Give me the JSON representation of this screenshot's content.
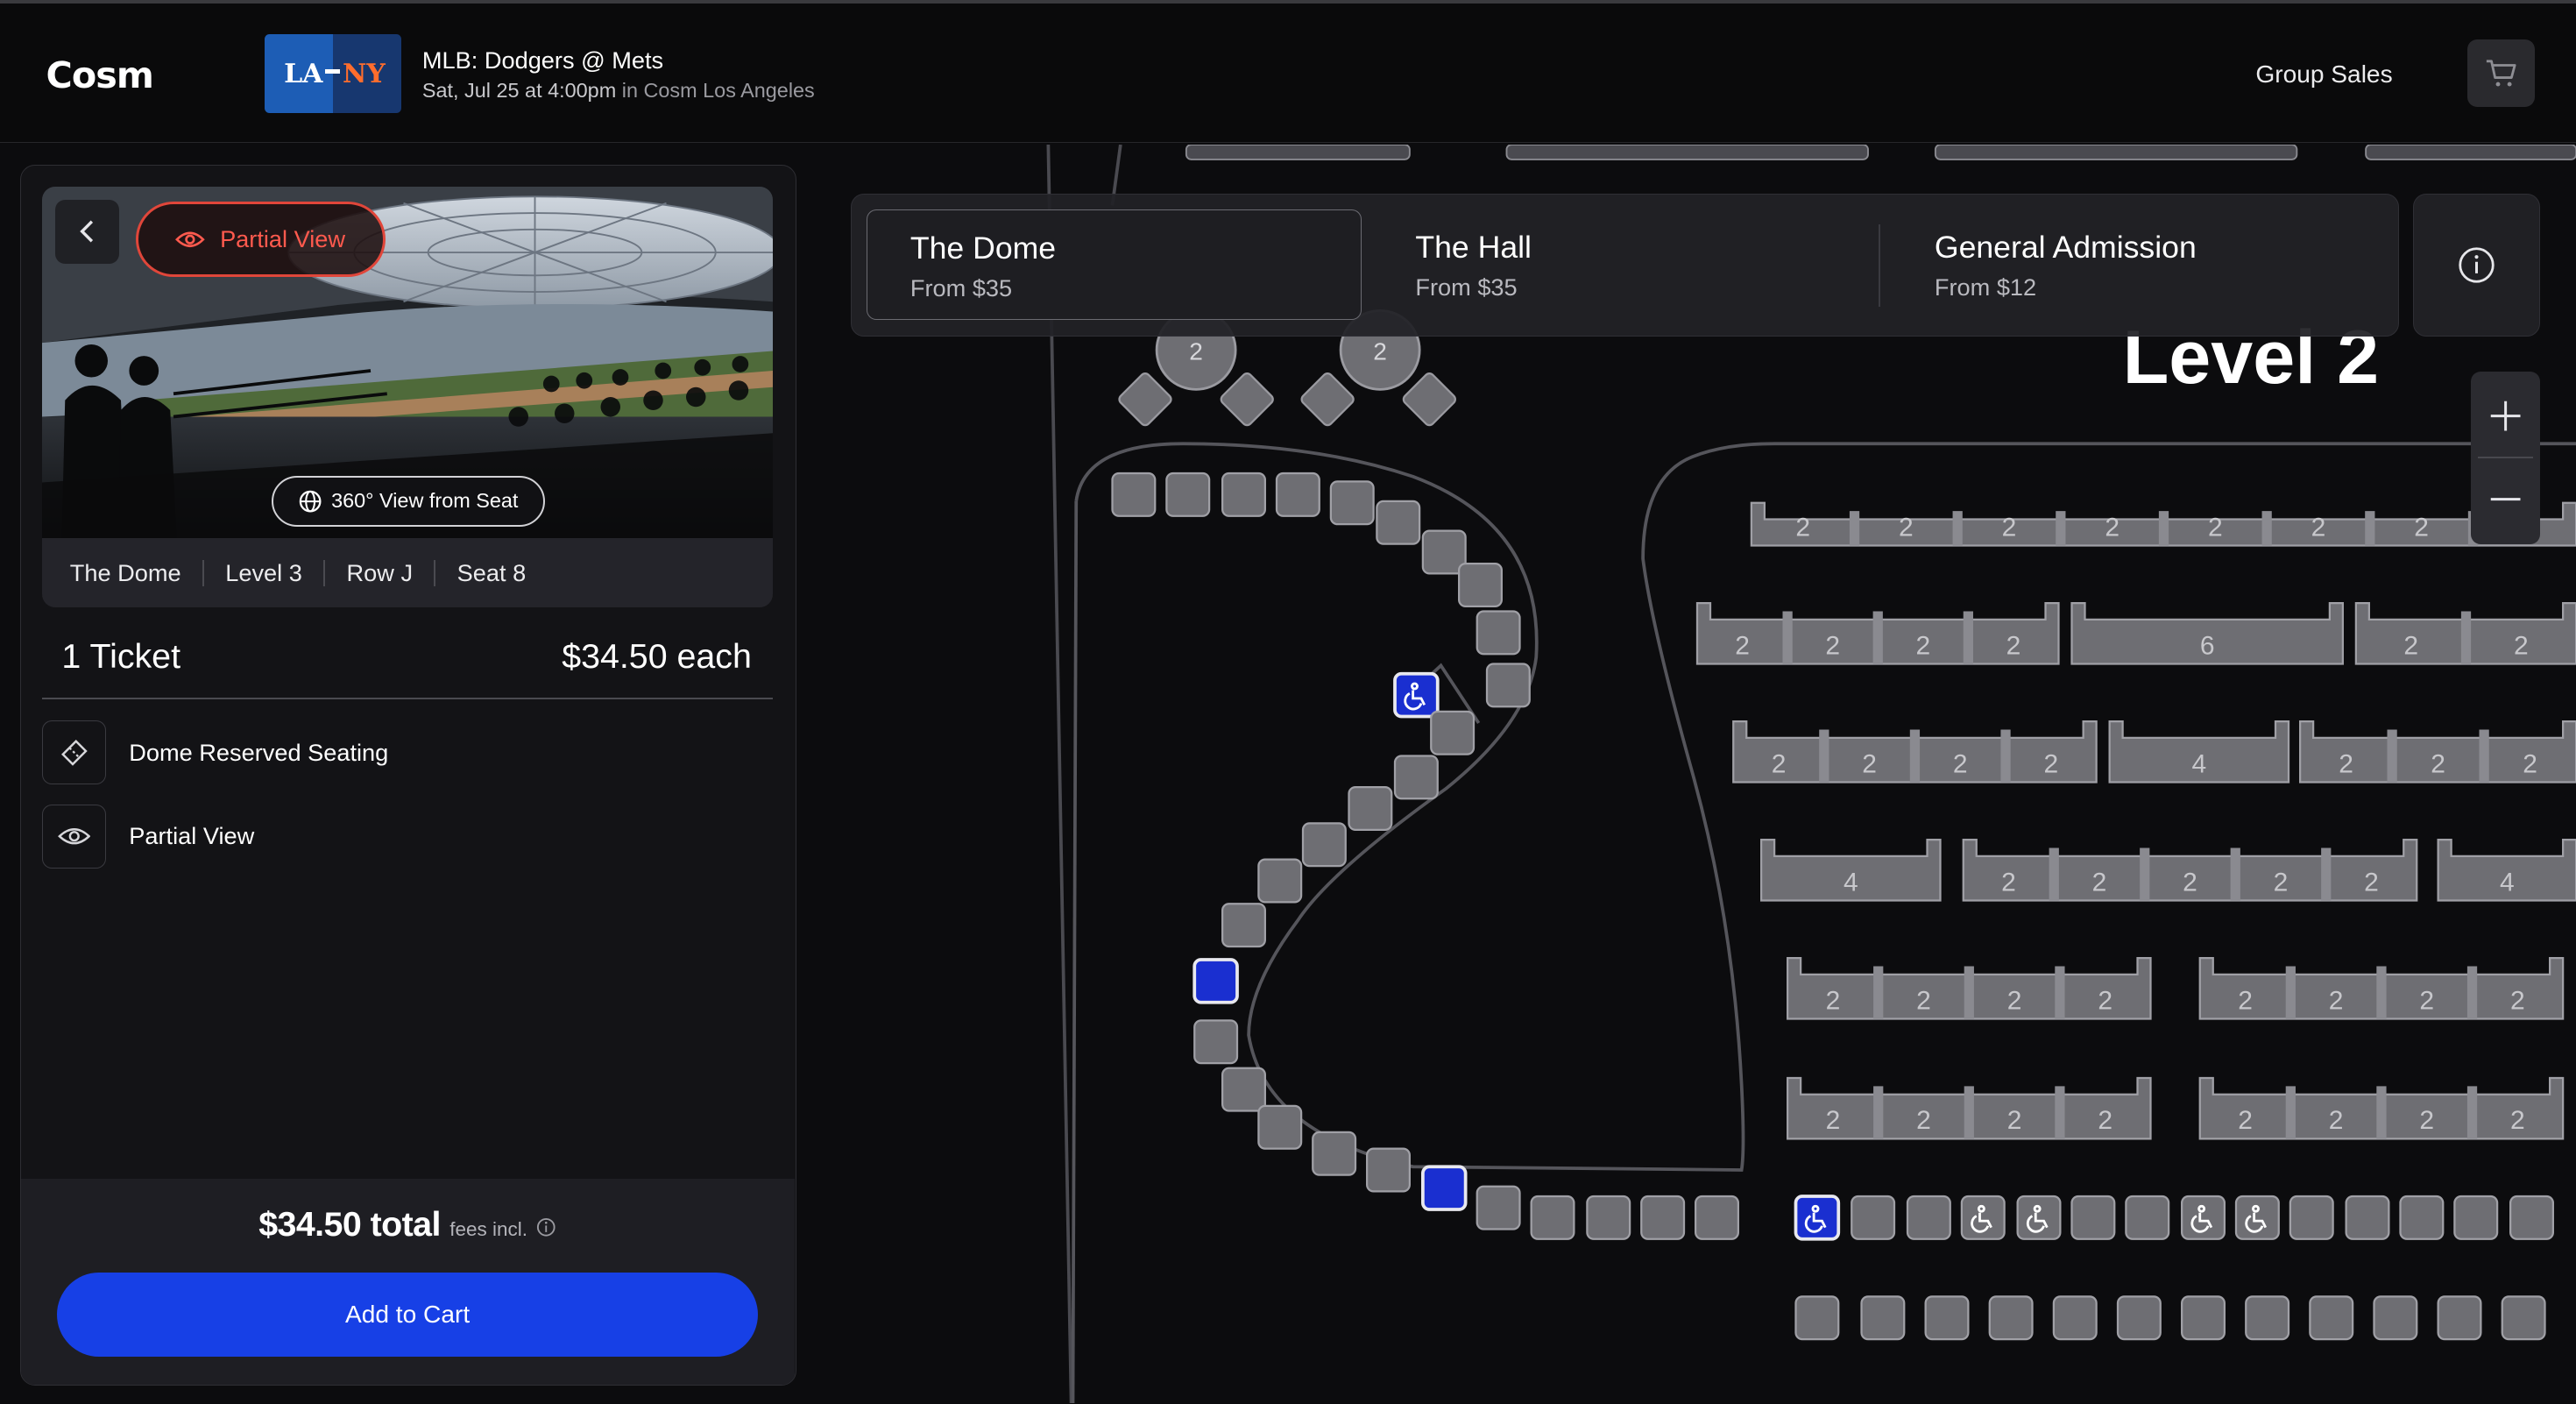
{
  "header": {
    "logo": "Cosm",
    "event_title": "MLB: Dodgers @ Mets",
    "event_datetime": "Sat, Jul 25 at 4:00pm",
    "event_location": "in Cosm Los Angeles",
    "away_logo": "LA",
    "home_logo": "NY",
    "group_sales": "Group Sales"
  },
  "panel": {
    "badge": "Partial View",
    "view_360": "360° View from Seat",
    "seat": {
      "section": "The Dome",
      "level_label": "Level",
      "level": "3",
      "row_label": "Row",
      "row": "J",
      "seat_label": "Seat",
      "seat": "8"
    },
    "tickets": "1 Ticket",
    "price_each": "$34.50 each",
    "features": [
      {
        "label": "Dome Reserved Seating",
        "icon": "ticket-icon"
      },
      {
        "label": "Partial View",
        "icon": "eye-icon"
      }
    ],
    "total": "$34.50 total",
    "fees": "fees incl.",
    "add_to_cart": "Add to Cart"
  },
  "tabs": [
    {
      "name": "The Dome",
      "price": "From $35",
      "selected": true
    },
    {
      "name": "The Hall",
      "price": "From $35",
      "selected": false
    },
    {
      "name": "General Admission",
      "price": "From $12",
      "selected": false
    }
  ],
  "map": {
    "level_label": "Level 2",
    "table_numbers": {
      "top_tables": [
        "2",
        "2"
      ],
      "row1": [
        "2",
        "2",
        "2",
        "2",
        "2",
        "2",
        "2",
        "2"
      ],
      "row2a": [
        "2",
        "2",
        "2",
        "2"
      ],
      "row2b": [
        "6"
      ],
      "row2c": [
        "2",
        "2"
      ],
      "row3a": [
        "2",
        "2",
        "2",
        "2"
      ],
      "row3b": [
        "4"
      ],
      "row3c": [
        "2",
        "2",
        "2"
      ],
      "row4a": [
        "4"
      ],
      "row4b": [
        "2",
        "2",
        "2",
        "2",
        "2"
      ],
      "row4c": [
        "4"
      ],
      "row5a": [
        "2",
        "2",
        "2",
        "2"
      ],
      "row5b": [
        "2",
        "2",
        "2",
        "2"
      ],
      "row6a": [
        "2",
        "2",
        "2",
        "2"
      ],
      "row6b": [
        "2",
        "2",
        "2",
        "2"
      ]
    },
    "colors": {
      "available": "#6e6e73",
      "selected": "#1a2fd0",
      "accent": "#1740e6",
      "badge": "#e0463a"
    }
  }
}
